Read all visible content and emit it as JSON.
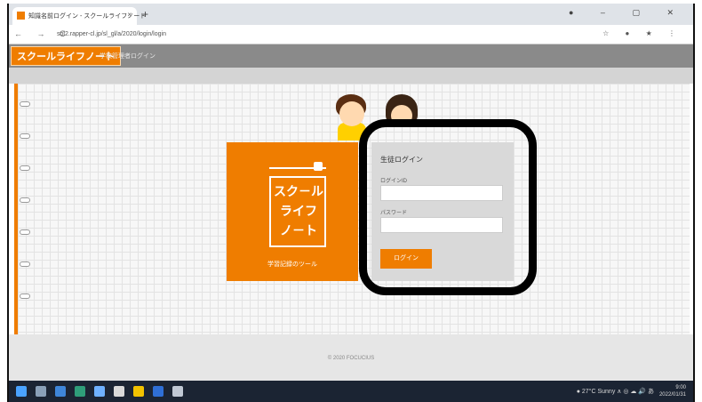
{
  "browser": {
    "tab_title": "知識名前ログイン - スクールライフノート",
    "tab_close": "×",
    "new_tab": "+",
    "url": "sol2.rapper-cl.jp/sl_gl/a/2020/login/login",
    "nav_glyphs": "← → C",
    "window_controls": "● – ▢ ✕",
    "extension_glyphs": "☆ ● ★ ⋮"
  },
  "app": {
    "brand": "スクールライフノート",
    "nav_link": "学校管理者ログイン",
    "logo_text": "スク－ル\nライフ\nノ－ト",
    "logo_caption": "学習記録のツール",
    "login": {
      "title": "生徒ログイン",
      "id_label": "ログインID",
      "id_value": "",
      "password_label": "パスワード",
      "password_value": "",
      "button": "ログイン"
    },
    "copyright": "© 2020 FOCUCIUS"
  },
  "taskbar": {
    "tray_text": "● 27°C Sunny  ∧  ◎  ☁  🔊  あ",
    "time": "9:00",
    "date": "2022/01/31"
  },
  "colors": {
    "accent": "#ef7d00",
    "header_gray": "#8a8a8a",
    "highlight": "#000000"
  }
}
